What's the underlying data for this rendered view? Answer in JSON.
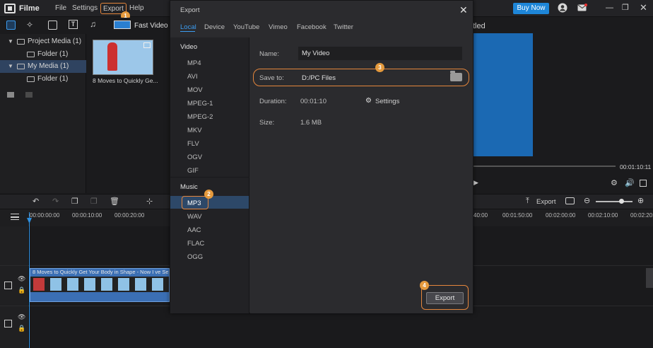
{
  "app": {
    "title": "Filme"
  },
  "menu": {
    "file": "File",
    "settings": "Settings",
    "export": "Export",
    "help": "Help",
    "buy_now": "Buy Now"
  },
  "badges": {
    "b1": "1",
    "b2": "2",
    "b3": "3",
    "b4": "4"
  },
  "toolbar": {
    "fast_video": "Fast Video"
  },
  "tree": {
    "project_media": "Project Media (1)",
    "project_folder": "Folder (1)",
    "my_media": "My Media (1)",
    "my_folder": "Folder (1)"
  },
  "media": {
    "clip_caption": "8 Moves to Quickly Ge..."
  },
  "preview": {
    "title_fragment": "tled",
    "timecode": "00:01:10:11"
  },
  "timeline": {
    "export_label": "Export",
    "ruler": [
      "00:00:00:00",
      "00:00:10:00",
      "00:00:20:00",
      "40:00",
      "00:01:50:00",
      "00:02:00:00",
      "00:02:10:00",
      "00:02:20:00"
    ],
    "clip_title": "8 Moves to Quickly Get Your Body in Shape - Now I ve Seen"
  },
  "dialog": {
    "title": "Export",
    "tabs": [
      "Local",
      "Device",
      "YouTube",
      "Vimeo",
      "Facebook",
      "Twitter"
    ],
    "video_header": "Video",
    "video_formats": [
      "MP4",
      "AVI",
      "MOV",
      "MPEG-1",
      "MPEG-2",
      "MKV",
      "FLV",
      "OGV",
      "GIF"
    ],
    "music_header": "Music",
    "music_formats": [
      "MP3",
      "WAV",
      "AAC",
      "FLAC",
      "OGG"
    ],
    "name_label": "Name:",
    "name_value": "My Video",
    "saveto_label": "Save to:",
    "saveto_value": "D:/PC Files",
    "duration_label": "Duration:",
    "duration_value": "00:01:10",
    "settings_label": "Settings",
    "size_label": "Size:",
    "size_value": "1.6 MB",
    "export_button": "Export"
  },
  "colors": {
    "accent": "#1e86d8",
    "highlight": "#e5863c",
    "selection": "#2d4868"
  }
}
